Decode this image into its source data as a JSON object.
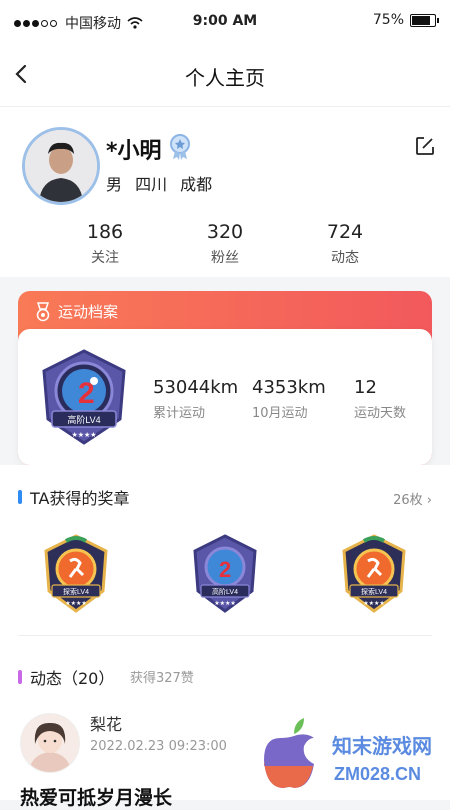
{
  "status_bar": {
    "carrier": "中国移动",
    "time": "9:00 AM",
    "battery": "75%"
  },
  "nav": {
    "title": "个人主页"
  },
  "profile": {
    "name": "*小明",
    "meta": "男 四川 成都"
  },
  "stats": [
    {
      "value": "186",
      "label": "关注"
    },
    {
      "value": "320",
      "label": "粉丝"
    },
    {
      "value": "724",
      "label": "动态"
    }
  ],
  "archive": {
    "title": "运动档案",
    "badge_text": "高阶LV4",
    "items": [
      {
        "value": "53044km",
        "label": "累计运动"
      },
      {
        "value": "4353km",
        "label": "10月运动"
      },
      {
        "value": "12",
        "label": "运动天数"
      }
    ]
  },
  "awards": {
    "title": "TA获得的奖章",
    "count": "26枚",
    "badge_labels": [
      "探索LV4",
      "高阶LV4",
      "探索LV4"
    ]
  },
  "feed": {
    "title": "动态（20）",
    "liked": "获得327赞",
    "post": {
      "name": "梨花",
      "time": "2022.02.23 09:23:00",
      "text": "热爱可抵岁月漫长"
    }
  },
  "watermark": {
    "line1": "知末游戏网",
    "line2": "ZM028.CN"
  },
  "colors": {
    "accent_red": "#f2595c",
    "accent_orange": "#f97a56",
    "blue": "#2f8cf5",
    "purple": "#c869e8"
  }
}
